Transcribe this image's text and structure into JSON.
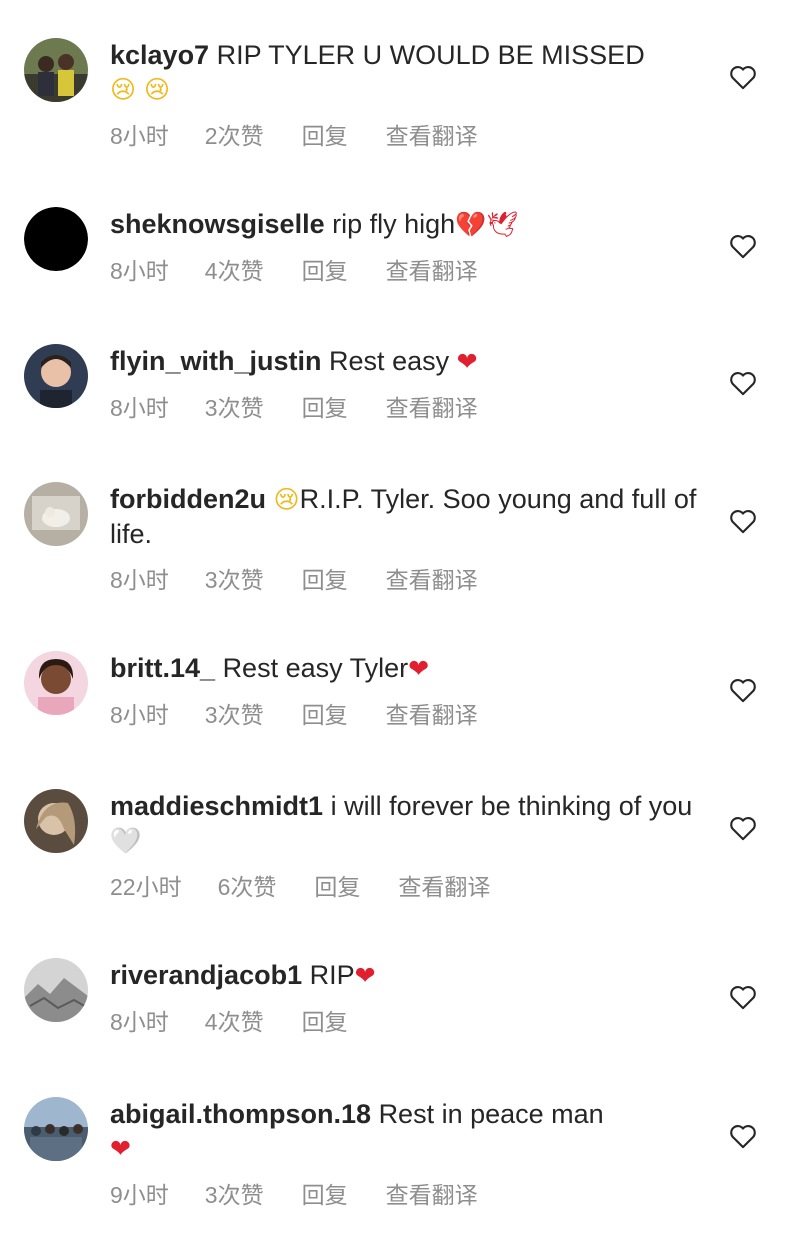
{
  "comments": [
    {
      "username": "kclayo7",
      "text": "RIP TYLER U WOULD BE MISSED",
      "emoji": "😢 😢",
      "time": "8小时",
      "likes": "2次赞",
      "reply": "回复",
      "translate": "查看翻译",
      "avatar_color": "#4b5a3a"
    },
    {
      "username": "sheknowsgiselle",
      "text": "rip fly high",
      "emoji": "💔🕊",
      "time": "8小时",
      "likes": "4次赞",
      "reply": "回复",
      "translate": "查看翻译",
      "avatar_color": "#000000"
    },
    {
      "username": "flyin_with_justin",
      "text": "Rest easy",
      "emoji": "❤",
      "time": "8小时",
      "likes": "3次赞",
      "reply": "回复",
      "translate": "查看翻译",
      "avatar_color": "#3a4a66"
    },
    {
      "username": "forbidden2u",
      "text": "R.I.P. Tyler. Soo young and full of life.",
      "emoji": "😢",
      "time": "8小时",
      "likes": "3次赞",
      "reply": "回复",
      "translate": "查看翻译",
      "avatar_color": "#a9a49a"
    },
    {
      "username": "britt.14_",
      "text": "Rest easy Tyler",
      "emoji": "❤",
      "time": "8小时",
      "likes": "3次赞",
      "reply": "回复",
      "translate": "查看翻译",
      "avatar_color": "#6b3d34"
    },
    {
      "username": "maddieschmidt1",
      "text": "i will forever be thinking of you",
      "emoji": "🤍",
      "time": "22小时",
      "likes": "6次赞",
      "reply": "回复",
      "translate": "查看翻译",
      "avatar_color": "#8a7d6c"
    },
    {
      "username": "riverandjacob1",
      "text": "RIP",
      "emoji": "❤",
      "time": "8小时",
      "likes": "4次赞",
      "reply": "回复",
      "translate": "",
      "avatar_color": "#b8b8b8"
    },
    {
      "username": "abigail.thompson.18",
      "text": "Rest in peace man",
      "emoji": "❤",
      "time": "9小时",
      "likes": "3次赞",
      "reply": "回复",
      "translate": "查看翻译",
      "avatar_color": "#6f8aa8"
    }
  ]
}
